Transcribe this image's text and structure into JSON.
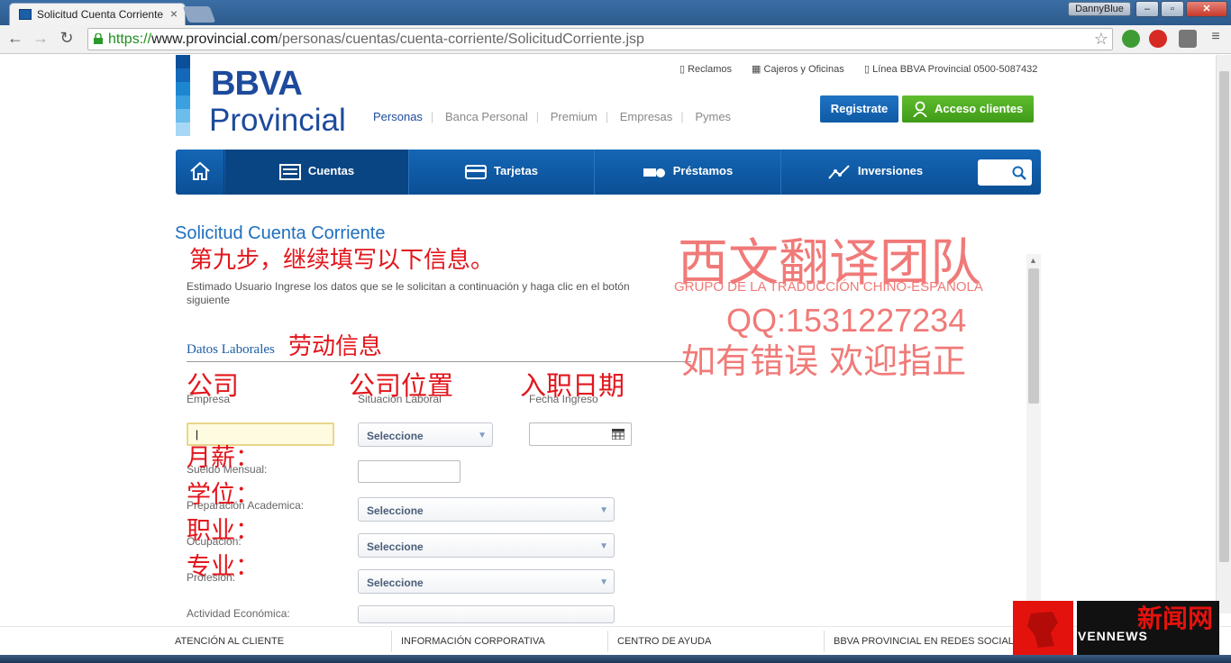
{
  "browser": {
    "tab_title": "Solicitud Cuenta Corriente",
    "user": "DannyBlue",
    "url_scheme": "https://",
    "url_host": "www.provincial.com",
    "url_path": "/personas/cuentas/cuenta-corriente/SolicitudCorriente.jsp"
  },
  "header": {
    "logo_line1": "BBVA",
    "logo_line2": "Provincial",
    "segments": [
      "Personas",
      "Banca Personal",
      "Premium",
      "Empresas",
      "Pymes"
    ],
    "top_links": [
      "Reclamos",
      "Cajeros y Oficinas",
      "Línea BBVA Provincial 0500-5087432"
    ],
    "register_label": "Registrate",
    "access_label": "Acceso clientes"
  },
  "nav": {
    "items": [
      "Cuentas",
      "Tarjetas",
      "Préstamos",
      "Inversiones"
    ]
  },
  "content": {
    "title": "Solicitud Cuenta Corriente",
    "intro": "Estimado Usuario Ingrese los datos que se le solicitan a continuación y haga clic en el botón siguiente",
    "section": "Datos Laborales",
    "labels": {
      "empresa": "Empresa",
      "situacion": "Situación Laboral",
      "fecha": "Fecha Ingreso",
      "sueldo": "Sueldo Mensual:",
      "preparacion": "Preparación Academica:",
      "ocupacion": "Ocupación:",
      "profesion": "Profesión:",
      "actividad": "Actividad Económica:"
    },
    "select_placeholder": "Seleccione",
    "empresa_value": "|"
  },
  "annotations": {
    "step": "第九步，继续填写以下信息。",
    "section": "劳动信息",
    "company": "公司",
    "location": "公司位置",
    "date": "入职日期",
    "salary": "月薪：",
    "degree": "学位：",
    "job": "职业：",
    "major": "专业："
  },
  "watermark": {
    "team": "西文翻译团队",
    "team_es": "GRUPO DE LA TRADUCCIÓN CHINO-ESPAÑOLA",
    "qq": "QQ:1531227234",
    "note": "如有错误 欢迎指正"
  },
  "footer": {
    "links": [
      "ATENCIÓN AL CLIENTE",
      "INFORMACIÓN CORPORATIVA",
      "CENTRO DE AYUDA",
      "BBVA PROVINCIAL EN REDES SOCIALES"
    ]
  },
  "news_logo": {
    "title": "新闻网",
    "sub": "VENNEWS"
  },
  "colors": {
    "brand_blue": "#1d4a9c",
    "nav_blue": "#1466b5",
    "access_green": "#4aa81f",
    "annotation_red": "#e2161c"
  }
}
